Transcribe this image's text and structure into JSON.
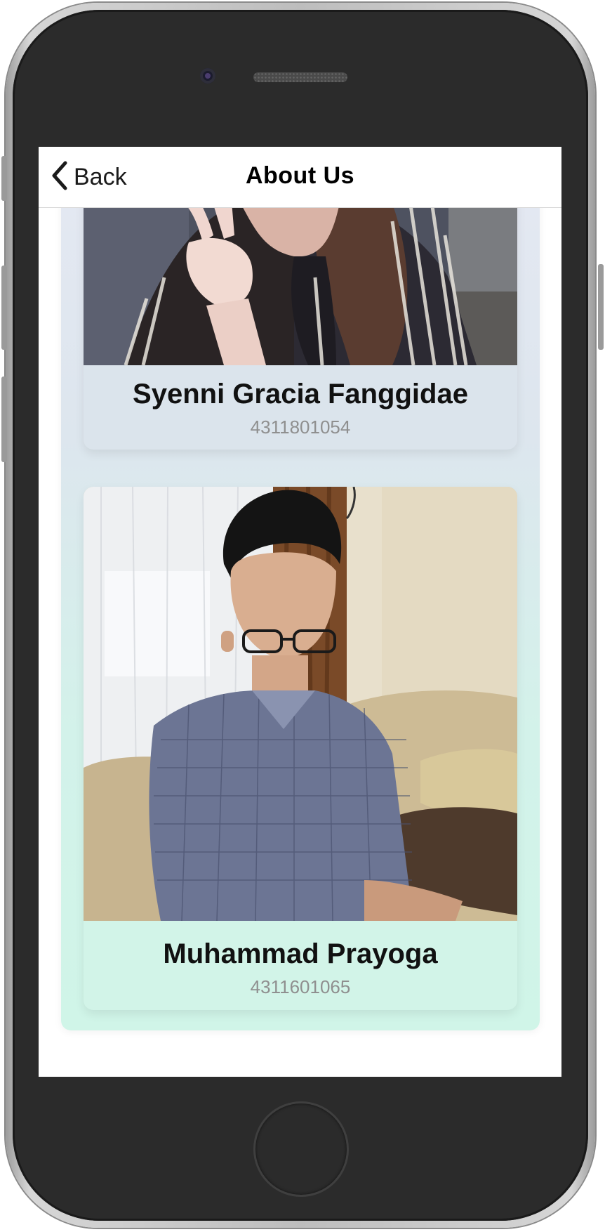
{
  "navbar": {
    "back_label": "Back",
    "title": "About Us"
  },
  "members": [
    {
      "name": "Syenni Gracia Fanggidae",
      "id": "4311801054"
    },
    {
      "name": "Muhammad Prayoga",
      "id": "4311601065"
    }
  ],
  "icons": {
    "back": "chevron-left-icon"
  },
  "colors": {
    "panel_top": "#e4e8f2",
    "panel_bottom": "#d0f5e8",
    "card_1_bg": "#dbe4ec",
    "card_2_bg": "#d2f4e8",
    "id_text": "#8f8f8f"
  }
}
